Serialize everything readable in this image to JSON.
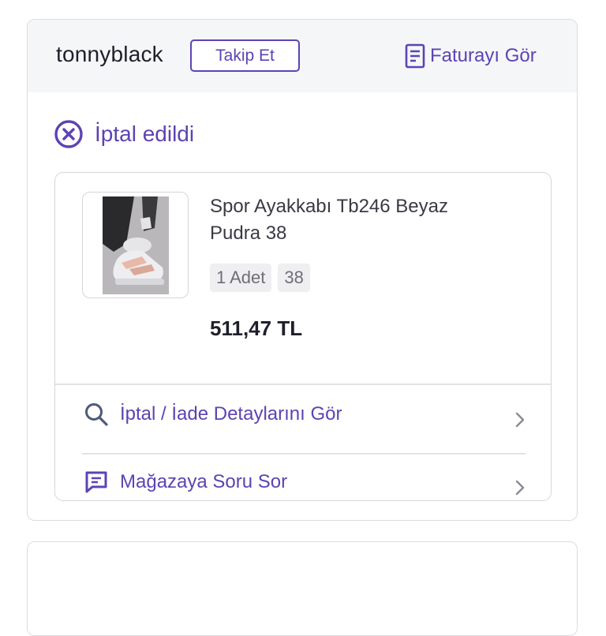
{
  "header": {
    "store_name": "tonnyblack",
    "follow_label": "Takip Et",
    "invoice_label": "Faturayı Gör",
    "invoice_icon": "document-icon"
  },
  "status": {
    "label": "İptal edildi",
    "icon": "cancel-circle-icon"
  },
  "product": {
    "title": "Spor Ayakkabı Tb246 Beyaz Pudra 38",
    "quantity": "1 Adet",
    "size": "38",
    "price": "511,47 TL"
  },
  "actions": [
    {
      "label": "İptal / İade Detaylarını Gör",
      "icon": "search-icon"
    },
    {
      "label": "Mağazaya Soru Sor",
      "icon": "message-icon"
    }
  ],
  "colors": {
    "accent": "#5c43b3",
    "header_bg": "#f5f6f8",
    "border": "#dcdce2"
  }
}
